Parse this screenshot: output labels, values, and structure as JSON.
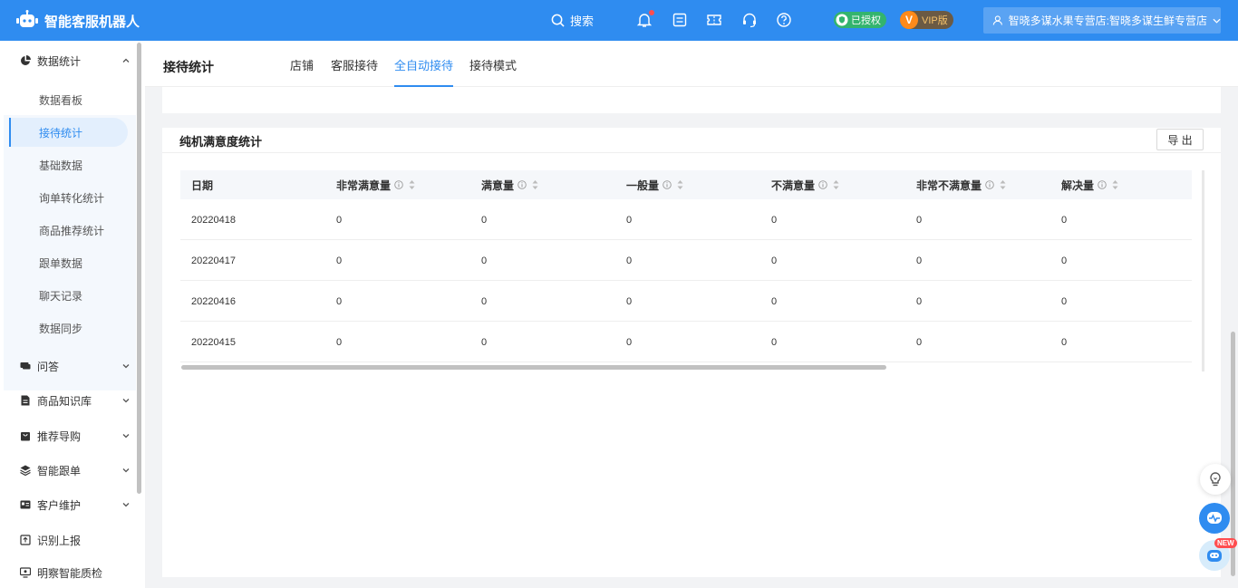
{
  "app": {
    "title": "智能客服机器人"
  },
  "topbar": {
    "search_label": "搜索",
    "auth_badge": "已授权",
    "vip_badge": "VIP版",
    "vip_letter": "V",
    "user_store": "智晓多谋水果专营店:智晓多谋生鲜专营店"
  },
  "sidebar": {
    "groups": [
      {
        "label": "数据统计",
        "icon": "pie-chart-icon",
        "expanded": true
      },
      {
        "label": "问答",
        "icon": "chat-icon"
      },
      {
        "label": "商品知识库",
        "icon": "document-icon"
      },
      {
        "label": "推荐导购",
        "icon": "bag-icon"
      },
      {
        "label": "智能跟单",
        "icon": "layers-icon"
      },
      {
        "label": "客户维护",
        "icon": "id-card-icon"
      },
      {
        "label": "识别上报",
        "icon": "report-icon"
      },
      {
        "label": "明察智能质检",
        "icon": "monitor-icon"
      }
    ],
    "sub_items": [
      {
        "label": "数据看板"
      },
      {
        "label": "接待统计",
        "active": true
      },
      {
        "label": "基础数据"
      },
      {
        "label": "询单转化统计"
      },
      {
        "label": "商品推荐统计"
      },
      {
        "label": "跟单数据"
      },
      {
        "label": "聊天记录"
      },
      {
        "label": "数据同步"
      }
    ]
  },
  "header": {
    "page_title": "接待统计",
    "tabs": [
      {
        "label": "店铺"
      },
      {
        "label": "客服接待"
      },
      {
        "label": "全自动接待",
        "active": true
      },
      {
        "label": "接待模式"
      }
    ]
  },
  "card": {
    "title": "纯机满意度统计",
    "export_label": "导 出"
  },
  "table": {
    "columns": [
      "日期",
      "非常满意量",
      "满意量",
      "一般量",
      "不满意量",
      "非常不满意量",
      "解决量"
    ],
    "rows": [
      [
        "20220418",
        "0",
        "0",
        "0",
        "0",
        "0",
        "0"
      ],
      [
        "20220417",
        "0",
        "0",
        "0",
        "0",
        "0",
        "0"
      ],
      [
        "20220416",
        "0",
        "0",
        "0",
        "0",
        "0",
        "0"
      ],
      [
        "20220415",
        "0",
        "0",
        "0",
        "0",
        "0",
        "0"
      ]
    ]
  },
  "float": {
    "new_badge": "NEW"
  },
  "colors": {
    "primary": "#2f8cf0",
    "auth": "#33b46e",
    "vip": "#ff8a1a"
  }
}
